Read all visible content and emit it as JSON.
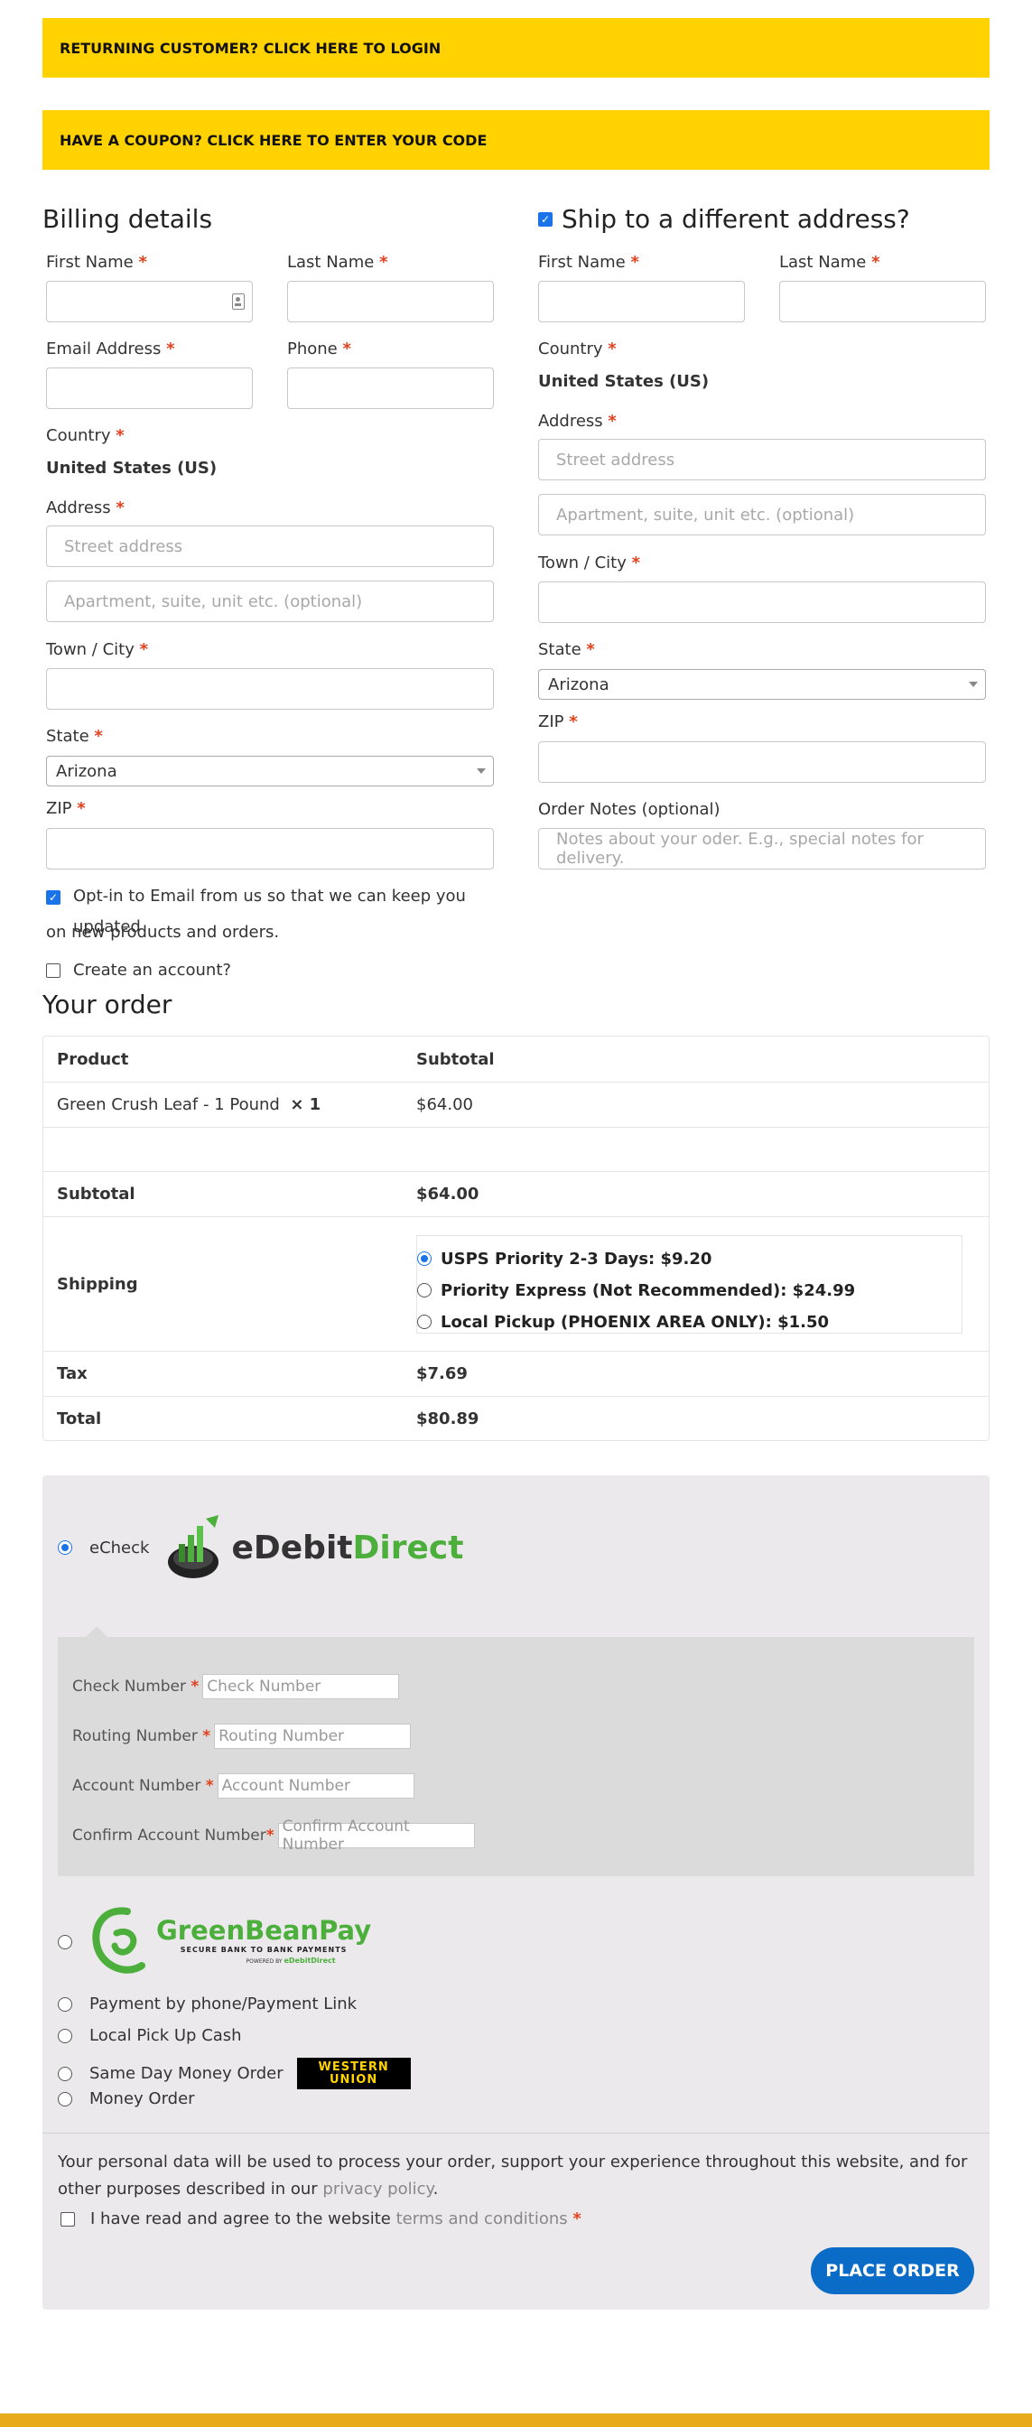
{
  "notices": {
    "login": "RETURNING CUSTOMER? CLICK HERE TO LOGIN",
    "coupon": "HAVE A COUPON? CLICK HERE TO ENTER YOUR CODE"
  },
  "billing": {
    "title": "Billing details",
    "first_name_label": "First Name",
    "last_name_label": "Last Name",
    "email_label": "Email Address",
    "phone_label": "Phone",
    "country_label": "Country",
    "country_value": "United States (US)",
    "address_label": "Address",
    "street_placeholder": "Street address",
    "apartment_placeholder": "Apartment, suite, unit etc. (optional)",
    "city_label": "Town / City",
    "state_label": "State",
    "state_value": "Arizona",
    "zip_label": "ZIP",
    "optin_text_1": "Opt-in to Email from us so that we can keep you updated",
    "optin_text_2": "on new products and orders.",
    "create_account": "Create an account?"
  },
  "shipping": {
    "title": "Ship to a different address?",
    "first_name_label": "First Name",
    "last_name_label": "Last Name",
    "country_label": "Country",
    "country_value": "United States (US)",
    "address_label": "Address",
    "street_placeholder": "Street address",
    "apartment_placeholder": "Apartment, suite, unit etc. (optional)",
    "city_label": "Town / City",
    "state_label": "State",
    "state_value": "Arizona",
    "zip_label": "ZIP",
    "notes_label": "Order Notes (optional)",
    "notes_placeholder": "Notes about your oder. E.g., special notes for delivery."
  },
  "required_mark": "*",
  "order": {
    "title": "Your order",
    "col_product": "Product",
    "col_subtotal": "Subtotal",
    "item_name": "Green Crush Leaf - 1 Pound",
    "item_qty": "× 1",
    "item_total": "$64.00",
    "subtotal_label": "Subtotal",
    "subtotal_value": "$64.00",
    "shipping_label": "Shipping",
    "shipping_options": [
      "USPS Priority 2-3 Days: $9.20",
      "Priority Express (Not Recommended): $24.99",
      "Local Pickup (PHOENIX AREA ONLY): $1.50"
    ],
    "tax_label": "Tax",
    "tax_value": "$7.69",
    "total_label": "Total",
    "total_value": "$80.89"
  },
  "payment": {
    "echeck_label": "eCheck",
    "edebit_logo": [
      "eDebit",
      "Direct"
    ],
    "check_number_label": "Check Number",
    "check_number_placeholder": "Check Number",
    "routing_label": "Routing Number",
    "routing_placeholder": "Routing Number",
    "account_label": "Account Number",
    "account_placeholder": "Account Number",
    "confirm_label": "Confirm Account Number",
    "confirm_placeholder": "Confirm Account Number",
    "greenbean_logo": "GreenBeanPay",
    "greenbean_tagline": "SECURE BANK TO BANK PAYMENTS",
    "greenbean_powered": "POWERED BY",
    "greenbean_powered_brand": "eDebitDirect",
    "phone_payment": "Payment by phone/Payment Link",
    "local_cash": "Local Pick Up Cash",
    "money_order_same_day": "Same Day Money Order",
    "western_union_logo": [
      "WESTERN",
      "UNION"
    ],
    "money_order": "Money Order",
    "privacy_text_1": "Your personal data will be used to process your order, support your experience throughout this website, and for other purposes described in our ",
    "privacy_link": "privacy policy",
    "privacy_end": ".",
    "terms_text": "I have read and agree to the website ",
    "terms_link": "terms and conditions",
    "place_order": "PLACE ORDER"
  },
  "colors": {
    "notice_bg": "#ffd200",
    "accent_blue": "#0a6cc6",
    "required_red": "#e2401c",
    "payment_bg": "#ebe9eb",
    "edebit_green": "#4caf3c",
    "footer_bar": "#e8a91a"
  }
}
